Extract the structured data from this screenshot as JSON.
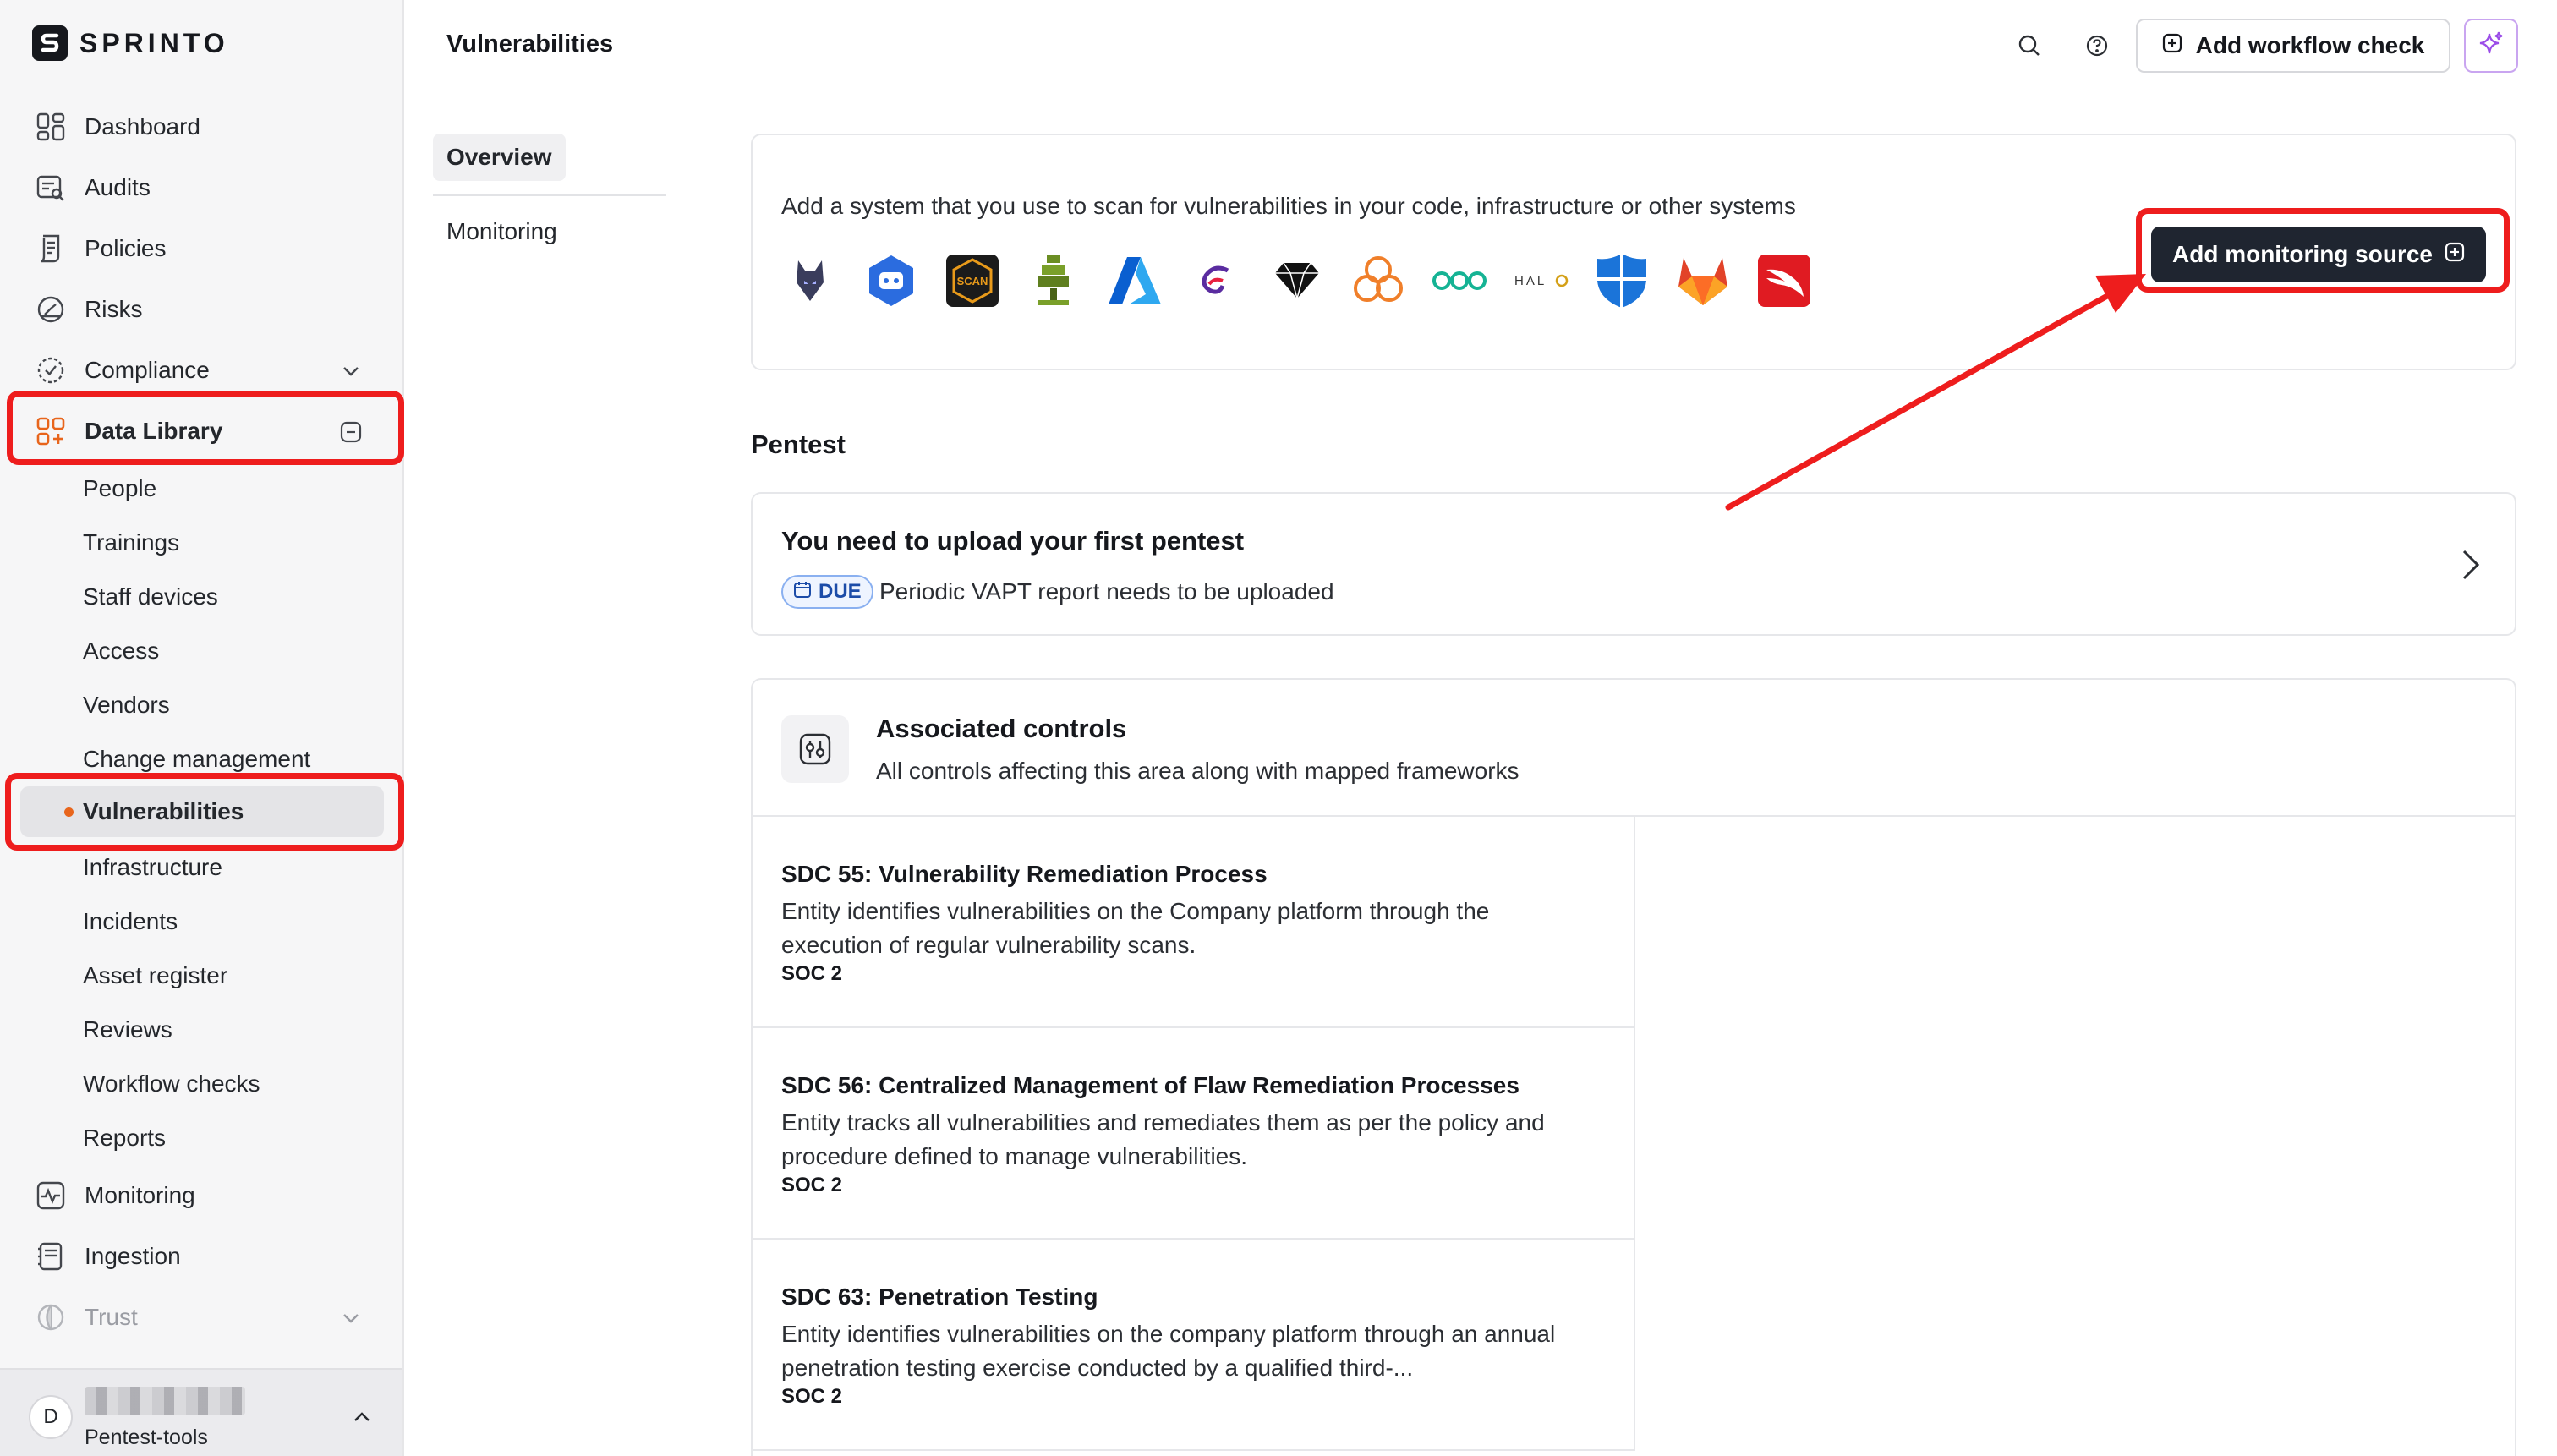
{
  "app": {
    "logo_text": "SPRINTO"
  },
  "sidebar": {
    "nav": [
      {
        "label": "Dashboard",
        "icon": "dashboard-icon"
      },
      {
        "label": "Audits",
        "icon": "audits-icon"
      },
      {
        "label": "Policies",
        "icon": "policies-icon"
      },
      {
        "label": "Risks",
        "icon": "risks-icon"
      },
      {
        "label": "Compliance",
        "icon": "compliance-icon"
      },
      {
        "label": "Data Library",
        "icon": "data-library-icon"
      },
      {
        "label": "Monitoring",
        "icon": "monitoring-icon"
      },
      {
        "label": "Ingestion",
        "icon": "ingestion-icon"
      },
      {
        "label": "Trust",
        "icon": "trust-icon"
      }
    ],
    "data_library_items": [
      "People",
      "Trainings",
      "Staff devices",
      "Access",
      "Vendors",
      "Change management",
      "Vulnerabilities",
      "Infrastructure",
      "Incidents",
      "Asset register",
      "Reviews",
      "Workflow checks",
      "Reports"
    ],
    "current_item": "Vulnerabilities",
    "footer": {
      "avatar_initial": "D",
      "org_sub": "Pentest-tools"
    }
  },
  "header": {
    "title": "Vulnerabilities",
    "add_workflow_label": "Add workflow check"
  },
  "subnav": {
    "tabs": [
      "Overview",
      "Monitoring"
    ],
    "active": "Overview"
  },
  "monitoring": {
    "description": "Add a system that you use to scan for vulnerabilities in your code, infrastructure or other systems",
    "button_label": "Add monitoring source",
    "tools": [
      "wolf-logo-icon",
      "bot-logo-icon",
      "scan-badge-icon",
      "aws-inspector-icon",
      "azure-icon",
      "swirl-logo-icon",
      "diamond-logo-icon",
      "cloud-logo-icon",
      "rings-logo-icon",
      "halo-logo-icon",
      "defender-shield-icon",
      "gitlab-icon",
      "crowdstrike-icon"
    ]
  },
  "pentest": {
    "section_title": "Pentest",
    "card_title": "You need to upload your first pentest",
    "badge": "DUE",
    "subtitle": "Periodic VAPT report needs to be uploaded"
  },
  "controls": {
    "title": "Associated controls",
    "subtitle": "All controls affecting this area along with mapped frameworks",
    "items": [
      {
        "title": "SDC 55: Vulnerability Remediation Process",
        "desc": "Entity identifies vulnerabilities on the Company platform through the execution of regular vulnerability scans.",
        "framework": "SOC 2"
      },
      {
        "title": "SDC 56: Centralized Management of Flaw Remediation Processes",
        "desc": "Entity tracks all vulnerabilities and remediates them as per the policy and procedure defined to manage vulnerabilities.",
        "framework": "SOC 2"
      },
      {
        "title": "SDC 63: Penetration Testing",
        "desc": "Entity identifies vulnerabilities on the company platform through an annual penetration testing exercise conducted by a qualified third-...",
        "framework": "SOC 2"
      }
    ]
  },
  "colors": {
    "accent_orange": "#e8651c",
    "annotation_red": "#ee1d1d",
    "dark_button": "#1f2530",
    "due_blue": "#1c4ca8"
  }
}
